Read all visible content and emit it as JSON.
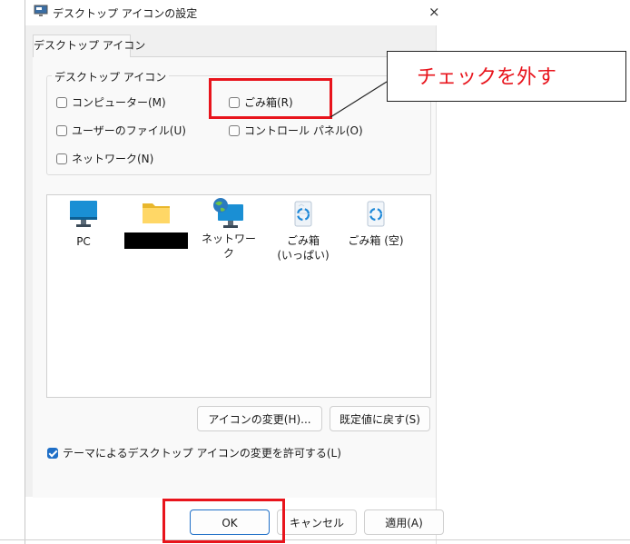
{
  "window": {
    "title": "デスクトップ アイコンの設定",
    "close_glyph": "×"
  },
  "tab": {
    "label": "デスクトップ アイコン"
  },
  "group": {
    "legend": "デスクトップ アイコン",
    "checkboxes": [
      {
        "label": "コンピューター(M)",
        "checked": false
      },
      {
        "label": "ごみ箱(R)",
        "checked": false
      },
      {
        "label": "ユーザーのファイル(U)",
        "checked": false
      },
      {
        "label": "コントロール パネル(O)",
        "checked": false
      },
      {
        "label": "ネットワーク(N)",
        "checked": false
      }
    ]
  },
  "icons": [
    {
      "label": "PC",
      "icon": "monitor-icon"
    },
    {
      "label": "",
      "icon": "folder-icon",
      "redacted": true
    },
    {
      "label": "ネットワーク",
      "icon": "network-globe-icon"
    },
    {
      "label": "ごみ箱",
      "sublabel": "(いっぱい)",
      "icon": "recycle-bin-full-icon"
    },
    {
      "label": "ごみ箱 (空)",
      "icon": "recycle-bin-empty-icon"
    }
  ],
  "buttons": {
    "change_icon": "アイコンの変更(H)...",
    "restore_default": "既定値に戻す(S)",
    "ok": "OK",
    "cancel": "キャンセル",
    "apply": "適用(A)"
  },
  "allow_themes": {
    "label": "テーマによるデスクトップ アイコンの変更を許可する(L)",
    "checked": true
  },
  "annotation": {
    "callout_text": "チェックを外す",
    "color": "#e8141c"
  },
  "colors": {
    "accent": "#1f6fc7",
    "highlight": "#e8141c"
  }
}
